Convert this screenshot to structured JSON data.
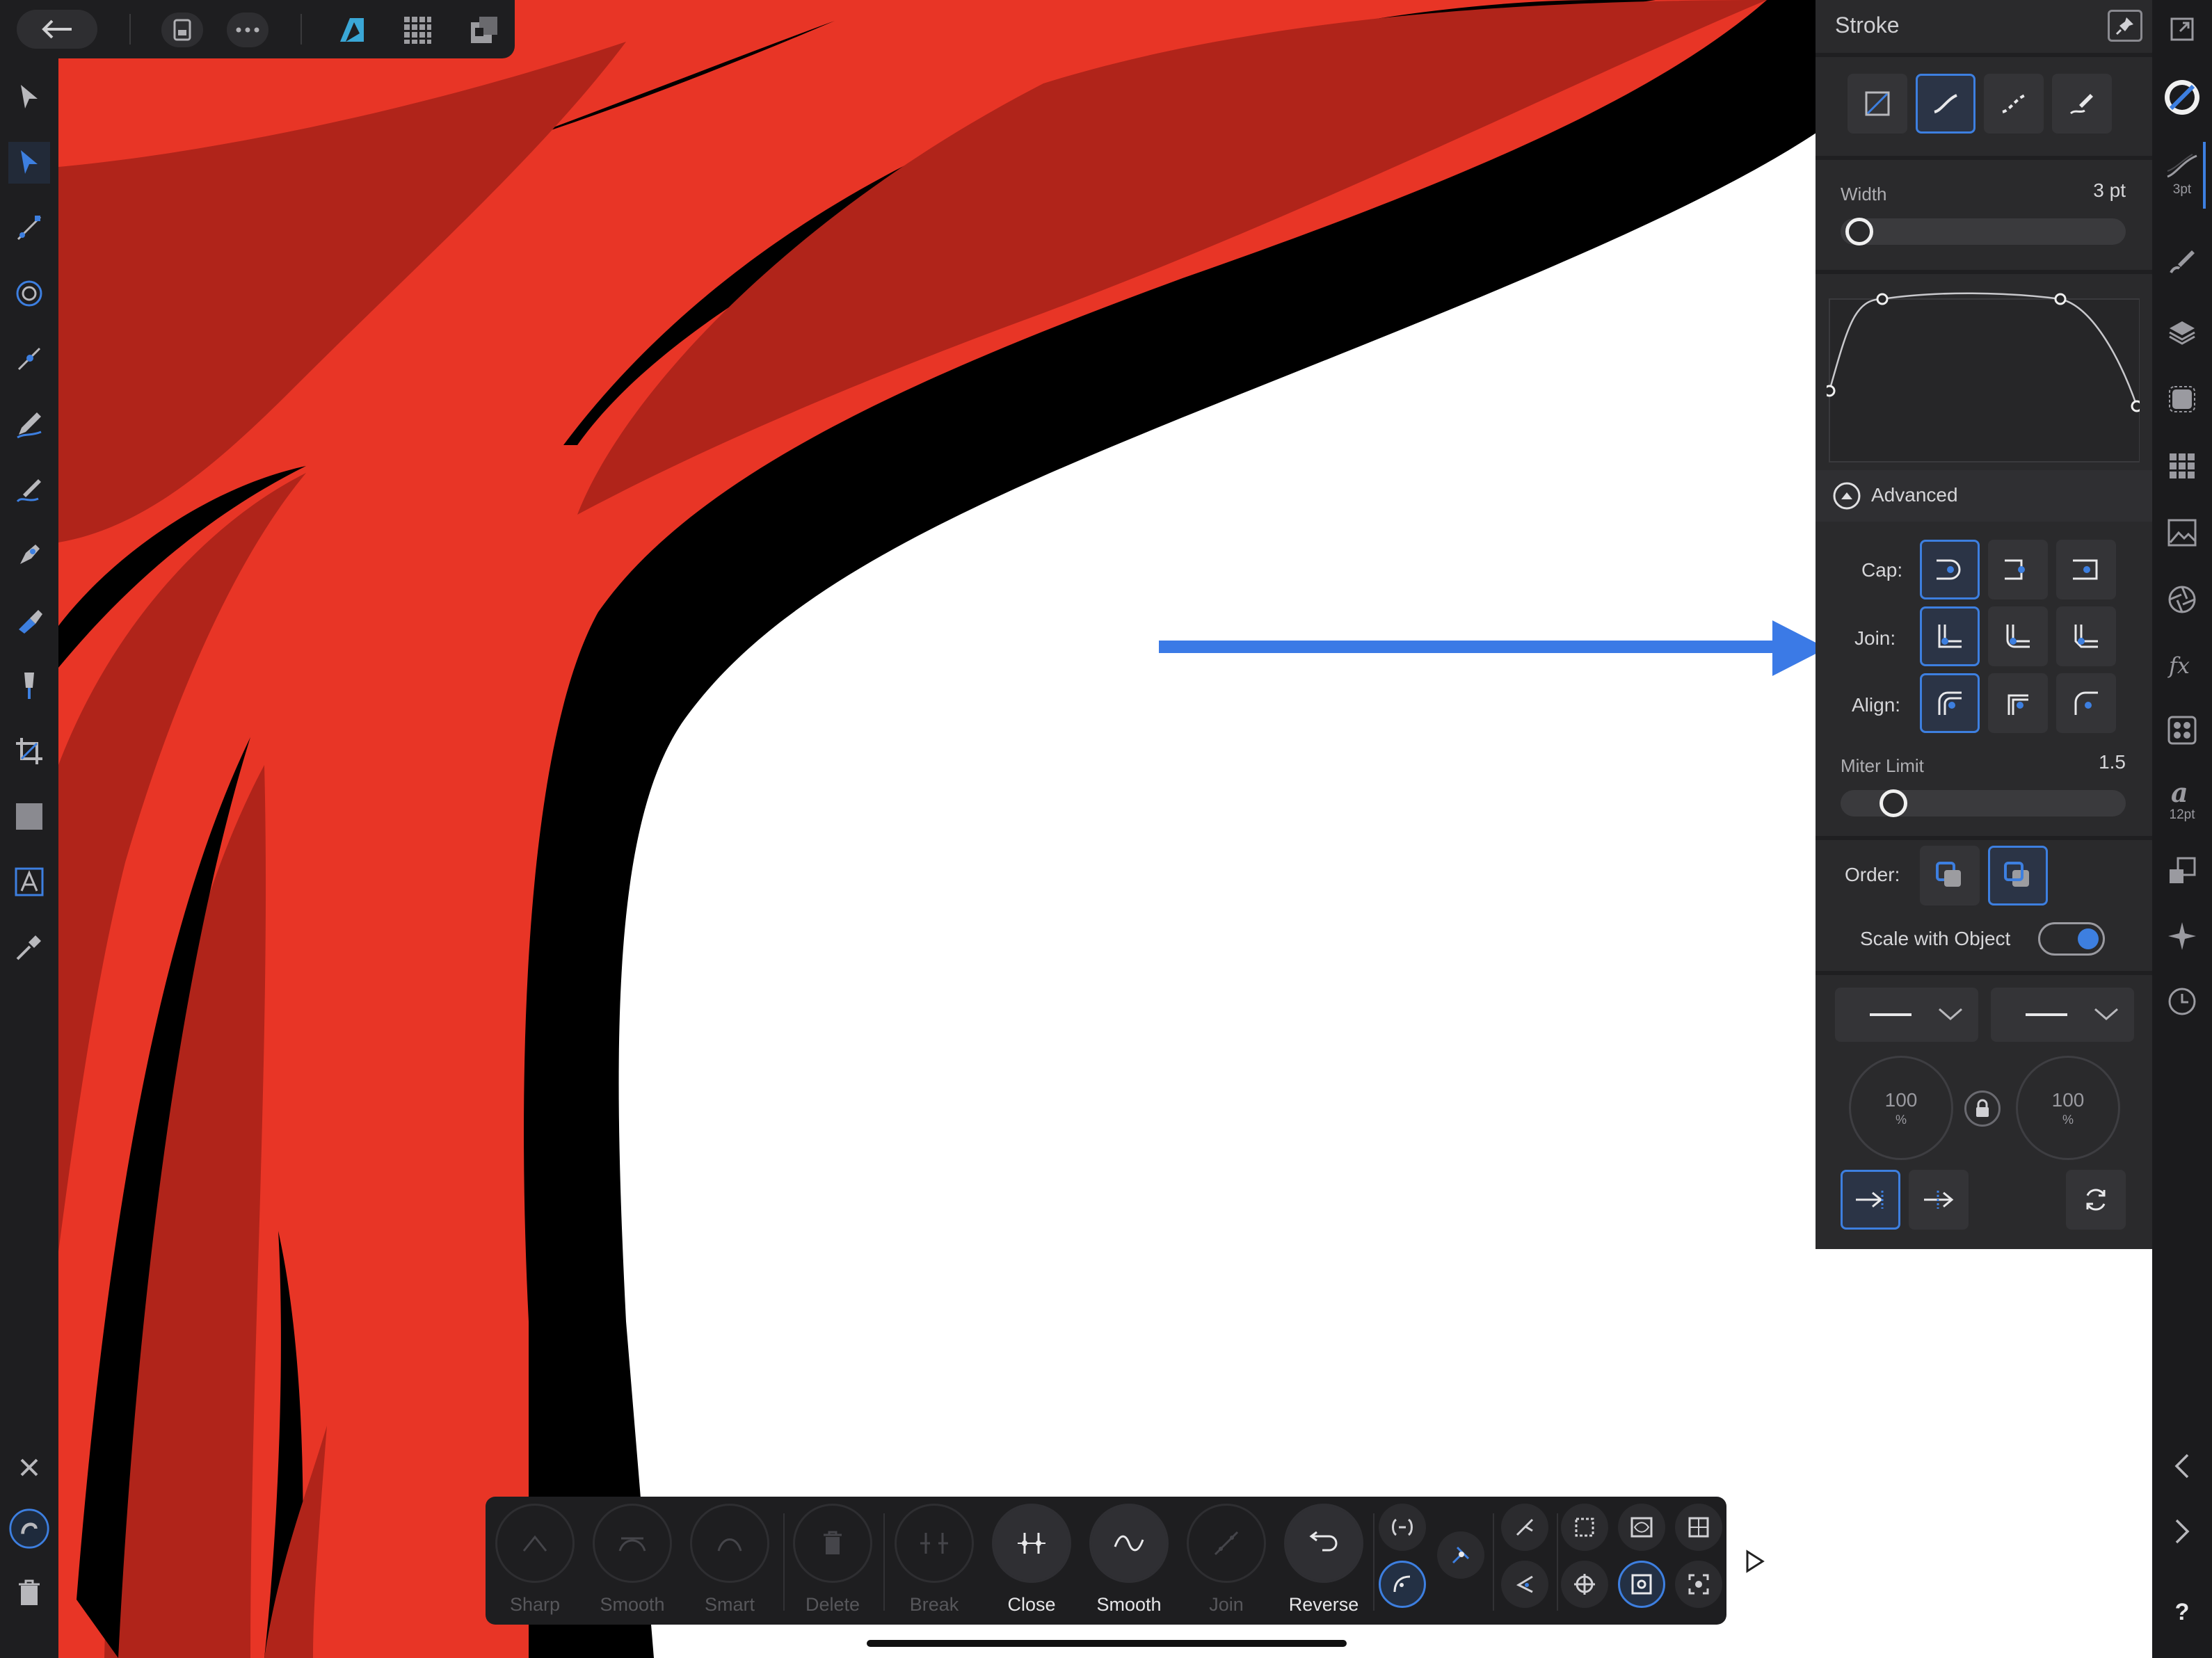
{
  "panel": {
    "title": "Stroke",
    "width_label": "Width",
    "width_value": "3 pt",
    "width_fraction": 0.02,
    "advanced_label": "Advanced",
    "cap_label": "Cap:",
    "join_label": "Join:",
    "align_label": "Align:",
    "miter_label": "Miter Limit",
    "miter_value": "1.5",
    "miter_fraction": 0.15,
    "order_label": "Order:",
    "scale_label": "Scale with Object",
    "scale_on": true,
    "start_scale": "100",
    "end_scale": "100",
    "percent": "%"
  },
  "right_strip": {
    "stroke_size": "3pt",
    "text_size": "12pt",
    "help": "?"
  },
  "bottom_toolbar": {
    "items": [
      {
        "label": "Sharp",
        "enabled": false
      },
      {
        "label": "Smooth",
        "enabled": false
      },
      {
        "label": "Smart",
        "enabled": false
      },
      {
        "label": "Delete",
        "enabled": false
      },
      {
        "label": "Break",
        "enabled": false
      },
      {
        "label": "Close",
        "enabled": true
      },
      {
        "label": "Smooth",
        "enabled": true
      },
      {
        "label": "Join",
        "enabled": false
      },
      {
        "label": "Reverse",
        "enabled": true
      }
    ]
  },
  "colors": {
    "accent": "#3d7fe0",
    "art_red": "#e83526",
    "art_dark_red": "#b0241a",
    "art_black": "#000000",
    "panel_bg": "#2a2a2c",
    "arrow": "#3b7ae6"
  },
  "icons": [
    "back-arrow-icon",
    "document-icon",
    "more-icon",
    "designer-persona-icon",
    "pixel-persona-icon",
    "export-persona-icon",
    "move-tool-icon",
    "node-tool-icon",
    "contour-tool-icon",
    "corner-tool-icon",
    "point-transform-icon",
    "pencil-tool-icon",
    "vector-brush-icon",
    "pen-tool-icon",
    "fill-tool-icon",
    "transparency-tool-icon",
    "crop-tool-icon",
    "rectangle-tool-icon",
    "text-tool-icon",
    "color-picker-icon",
    "close-icon",
    "snapping-icon",
    "trash-icon"
  ]
}
